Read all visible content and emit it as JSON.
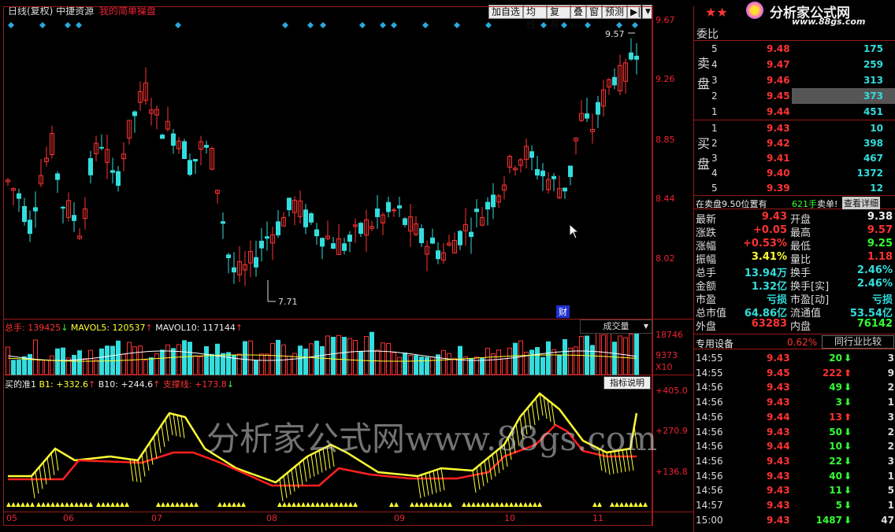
{
  "header": {
    "title_left": "日线(复权)  中捷资源",
    "title_right": "我的简单操盘",
    "buttons": [
      "加自选",
      "均线",
      "复权",
      "叠",
      "窗",
      "预测"
    ],
    "arrow_btn": "▶|",
    "dd_arrow": "▼"
  },
  "logo": {
    "stars": "★★",
    "name": "分析家公式网",
    "url": "www.88gs.com"
  },
  "watermark": "分析家公式网www.88gs.com",
  "price_axis": [
    "9.67",
    "9.26",
    "8.85",
    "8.44",
    "8.02"
  ],
  "annotations": {
    "high": "9.57",
    "low": "7.71",
    "fin": "财"
  },
  "volume_panel": {
    "label_total": "总手: 139425",
    "label_ma5": "MAVOL5: 120537",
    "label_ma10": "MAVOL10: 117144",
    "dropdown": "成交量",
    "axis": [
      "18746",
      "9373",
      "X10"
    ]
  },
  "indicator_panel": {
    "name": "买的准1",
    "b1": "B1: +332.6",
    "b10": "B10: +244.6",
    "support": "支撑线: +173.8",
    "button": "指标说明",
    "axis": [
      "+405.0",
      "+270.9",
      "+136.8"
    ]
  },
  "x_axis": [
    "05",
    "06",
    "07",
    "08",
    "09",
    "10",
    "11"
  ],
  "right_panel": {
    "committee_label": "委比",
    "sell_label": "卖盘",
    "buy_label": "买盘",
    "sell": [
      {
        "n": "5",
        "p": "9.48",
        "v": "175"
      },
      {
        "n": "4",
        "p": "9.47",
        "v": "259"
      },
      {
        "n": "3",
        "p": "9.46",
        "v": "313"
      },
      {
        "n": "2",
        "p": "9.45",
        "v": "373"
      },
      {
        "n": "1",
        "p": "9.44",
        "v": "451"
      }
    ],
    "buy": [
      {
        "n": "1",
        "p": "9.43",
        "v": "10"
      },
      {
        "n": "2",
        "p": "9.42",
        "v": "398"
      },
      {
        "n": "3",
        "p": "9.41",
        "v": "467"
      },
      {
        "n": "4",
        "p": "9.40",
        "v": "1372"
      },
      {
        "n": "5",
        "p": "9.39",
        "v": "12"
      }
    ],
    "notice_pre": "在卖盘9.50位置有",
    "notice_qty": "621手",
    "notice_post": "卖单!",
    "notice_link": "查看详细",
    "stats": [
      {
        "l1": "最新",
        "v1": "9.43",
        "c1": "red",
        "l2": "开盘",
        "v2": "9.38",
        "c2": "white"
      },
      {
        "l1": "涨跌",
        "v1": "+0.05",
        "c1": "red",
        "l2": "最高",
        "v2": "9.57",
        "c2": "red"
      },
      {
        "l1": "涨幅",
        "v1": "+0.53%",
        "c1": "red",
        "l2": "最低",
        "v2": "9.25",
        "c2": "green"
      },
      {
        "l1": "振幅",
        "v1": "3.41%",
        "c1": "yellow",
        "l2": "量比",
        "v2": "1.18",
        "c2": "red"
      },
      {
        "l1": "总手",
        "v1": "13.94万",
        "c1": "cyan",
        "l2": "换手",
        "v2": "2.46%",
        "c2": "cyan"
      },
      {
        "l1": "金额",
        "v1": "1.32亿",
        "c1": "cyan",
        "l2": "换手[实]",
        "v2": "2.46%",
        "c2": "cyan"
      },
      {
        "l1": "市盈",
        "v1": "亏损",
        "c1": "cyan",
        "l2": "市盈[动]",
        "v2": "亏损",
        "c2": "cyan"
      },
      {
        "l1": "总市值",
        "v1": "64.86亿",
        "c1": "cyan",
        "l2": "流通值",
        "v2": "53.54亿",
        "c2": "cyan"
      },
      {
        "l1": "外盘",
        "v1": "63283",
        "c1": "red",
        "l2": "内盘",
        "v2": "76142",
        "c2": "green"
      }
    ],
    "sector_name": "专用设备",
    "sector_pct": "0.62%",
    "peer_btn": "同行业比较",
    "ticks": [
      {
        "t": "14:55",
        "p": "9.43",
        "pc": "red",
        "v": "20",
        "dir": "down",
        "n": "3"
      },
      {
        "t": "14:55",
        "p": "9.45",
        "pc": "red",
        "v": "222",
        "dir": "up",
        "n": "9"
      },
      {
        "t": "14:56",
        "p": "9.43",
        "pc": "red",
        "v": "49",
        "dir": "down",
        "n": "2"
      },
      {
        "t": "14:56",
        "p": "9.43",
        "pc": "red",
        "v": "3",
        "dir": "down",
        "n": "1"
      },
      {
        "t": "14:56",
        "p": "9.44",
        "pc": "red",
        "v": "13",
        "dir": "up",
        "n": "3"
      },
      {
        "t": "14:56",
        "p": "9.43",
        "pc": "red",
        "v": "50",
        "dir": "down",
        "n": "2"
      },
      {
        "t": "14:56",
        "p": "9.44",
        "pc": "red",
        "v": "10",
        "dir": "down",
        "n": "2"
      },
      {
        "t": "14:56",
        "p": "9.43",
        "pc": "red",
        "v": "22",
        "dir": "down",
        "n": "3"
      },
      {
        "t": "14:56",
        "p": "9.43",
        "pc": "red",
        "v": "40",
        "dir": "down",
        "n": "1"
      },
      {
        "t": "14:56",
        "p": "9.43",
        "pc": "red",
        "v": "11",
        "dir": "down",
        "n": "5"
      },
      {
        "t": "14:57",
        "p": "9.43",
        "pc": "red",
        "v": "5",
        "dir": "down",
        "n": "1"
      },
      {
        "t": "15:00",
        "p": "9.43",
        "pc": "red",
        "v": "1487",
        "dir": "down",
        "n": "47"
      }
    ]
  },
  "colors": {
    "up": "#ff3333",
    "down": "#33dddd",
    "bg": "#000000",
    "frame": "#9a1a1a",
    "ma5": "#ffffff",
    "ma10": "#ffff33",
    "b1": "#ffff33",
    "support": "#ff2020"
  }
}
